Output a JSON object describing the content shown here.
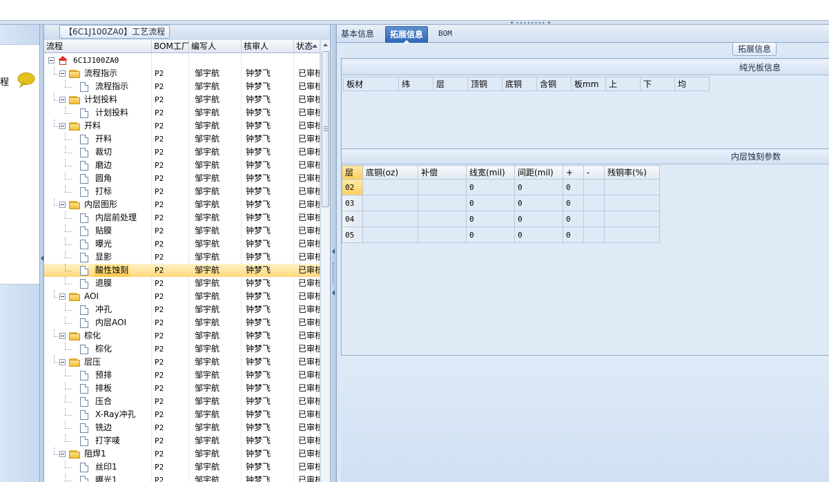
{
  "top": {
    "grip": "▾ ∙∙∙∙∙∙∙∙ ▾"
  },
  "left_panel": {
    "label": "程"
  },
  "tree": {
    "title": "【6C1J100ZA0】工艺流程",
    "columns": [
      "流程",
      "BOM工厂",
      "编写人",
      "核审人",
      "状态"
    ],
    "rows": [
      {
        "level": 0,
        "icon": "home",
        "name": "6C1J100ZA0",
        "bom": "",
        "writer": "",
        "reviewer": "",
        "status": "",
        "expanded": true
      },
      {
        "level": 1,
        "icon": "folder",
        "name": "流程指示",
        "bom": "P2",
        "writer": "邹宇航",
        "reviewer": "钟梦飞",
        "status": "已审核",
        "expanded": true
      },
      {
        "level": 2,
        "icon": "doc",
        "name": "流程指示",
        "bom": "P2",
        "writer": "邹宇航",
        "reviewer": "钟梦飞",
        "status": "已审核"
      },
      {
        "level": 1,
        "icon": "folder",
        "name": "计划投料",
        "bom": "P2",
        "writer": "邹宇航",
        "reviewer": "钟梦飞",
        "status": "已审核",
        "expanded": true
      },
      {
        "level": 2,
        "icon": "doc",
        "name": "计划投料",
        "bom": "P2",
        "writer": "邹宇航",
        "reviewer": "钟梦飞",
        "status": "已审核"
      },
      {
        "level": 1,
        "icon": "folder",
        "name": "开料",
        "bom": "P2",
        "writer": "邹宇航",
        "reviewer": "钟梦飞",
        "status": "已审核",
        "expanded": true
      },
      {
        "level": 2,
        "icon": "doc",
        "name": "开料",
        "bom": "P2",
        "writer": "邹宇航",
        "reviewer": "钟梦飞",
        "status": "已审核"
      },
      {
        "level": 2,
        "icon": "doc",
        "name": "裁切",
        "bom": "P2",
        "writer": "邹宇航",
        "reviewer": "钟梦飞",
        "status": "已审核"
      },
      {
        "level": 2,
        "icon": "doc",
        "name": "磨边",
        "bom": "P2",
        "writer": "邹宇航",
        "reviewer": "钟梦飞",
        "status": "已审核"
      },
      {
        "level": 2,
        "icon": "doc",
        "name": "圆角",
        "bom": "P2",
        "writer": "邹宇航",
        "reviewer": "钟梦飞",
        "status": "已审核"
      },
      {
        "level": 2,
        "icon": "doc",
        "name": "打标",
        "bom": "P2",
        "writer": "邹宇航",
        "reviewer": "钟梦飞",
        "status": "已审核"
      },
      {
        "level": 1,
        "icon": "folder",
        "name": "内层图形",
        "bom": "P2",
        "writer": "邹宇航",
        "reviewer": "钟梦飞",
        "status": "已审核",
        "expanded": true
      },
      {
        "level": 2,
        "icon": "doc",
        "name": "内层前处理",
        "bom": "P2",
        "writer": "邹宇航",
        "reviewer": "钟梦飞",
        "status": "已审核"
      },
      {
        "level": 2,
        "icon": "doc",
        "name": "贴膜",
        "bom": "P2",
        "writer": "邹宇航",
        "reviewer": "钟梦飞",
        "status": "已审核"
      },
      {
        "level": 2,
        "icon": "doc",
        "name": "曝光",
        "bom": "P2",
        "writer": "邹宇航",
        "reviewer": "钟梦飞",
        "status": "已审核"
      },
      {
        "level": 2,
        "icon": "doc",
        "name": "显影",
        "bom": "P2",
        "writer": "邹宇航",
        "reviewer": "钟梦飞",
        "status": "已审核"
      },
      {
        "level": 2,
        "icon": "doc",
        "name": "酸性蚀刻",
        "bom": "P2",
        "writer": "邹宇航",
        "reviewer": "钟梦飞",
        "status": "已审核",
        "selected": true
      },
      {
        "level": 2,
        "icon": "doc",
        "name": "退膜",
        "bom": "P2",
        "writer": "邹宇航",
        "reviewer": "钟梦飞",
        "status": "已审核"
      },
      {
        "level": 1,
        "icon": "folder",
        "name": "AOI",
        "bom": "P2",
        "writer": "邹宇航",
        "reviewer": "钟梦飞",
        "status": "已审核",
        "expanded": true
      },
      {
        "level": 2,
        "icon": "doc",
        "name": "冲孔",
        "bom": "P2",
        "writer": "邹宇航",
        "reviewer": "钟梦飞",
        "status": "已审核"
      },
      {
        "level": 2,
        "icon": "doc",
        "name": "内层AOI",
        "bom": "P2",
        "writer": "邹宇航",
        "reviewer": "钟梦飞",
        "status": "已审核"
      },
      {
        "level": 1,
        "icon": "folder",
        "name": "棕化",
        "bom": "P2",
        "writer": "邹宇航",
        "reviewer": "钟梦飞",
        "status": "已审核",
        "expanded": true
      },
      {
        "level": 2,
        "icon": "doc",
        "name": "棕化",
        "bom": "P2",
        "writer": "邹宇航",
        "reviewer": "钟梦飞",
        "status": "已审核"
      },
      {
        "level": 1,
        "icon": "folder",
        "name": "层压",
        "bom": "P2",
        "writer": "邹宇航",
        "reviewer": "钟梦飞",
        "status": "已审核",
        "expanded": true
      },
      {
        "level": 2,
        "icon": "doc",
        "name": "预排",
        "bom": "P2",
        "writer": "邹宇航",
        "reviewer": "钟梦飞",
        "status": "已审核"
      },
      {
        "level": 2,
        "icon": "doc",
        "name": "排板",
        "bom": "P2",
        "writer": "邹宇航",
        "reviewer": "钟梦飞",
        "status": "已审核"
      },
      {
        "level": 2,
        "icon": "doc",
        "name": "压合",
        "bom": "P2",
        "writer": "邹宇航",
        "reviewer": "钟梦飞",
        "status": "已审核"
      },
      {
        "level": 2,
        "icon": "doc",
        "name": "X-Ray冲孔",
        "bom": "P2",
        "writer": "邹宇航",
        "reviewer": "钟梦飞",
        "status": "已审核"
      },
      {
        "level": 2,
        "icon": "doc",
        "name": "铣边",
        "bom": "P2",
        "writer": "邹宇航",
        "reviewer": "钟梦飞",
        "status": "已审核"
      },
      {
        "level": 2,
        "icon": "doc",
        "name": "打字唛",
        "bom": "P2",
        "writer": "邹宇航",
        "reviewer": "钟梦飞",
        "status": "已审核"
      },
      {
        "level": 1,
        "icon": "folder",
        "name": "阻焊1",
        "bom": "P2",
        "writer": "邹宇航",
        "reviewer": "钟梦飞",
        "status": "已审核",
        "expanded": true
      },
      {
        "level": 2,
        "icon": "doc",
        "name": "丝印1",
        "bom": "P2",
        "writer": "邹宇航",
        "reviewer": "钟梦飞",
        "status": "已审核"
      },
      {
        "level": 2,
        "icon": "doc",
        "name": "曝光1",
        "bom": "P2",
        "writer": "邹宇航",
        "reviewer": "钟梦飞",
        "status": "已审核"
      }
    ]
  },
  "right": {
    "tabs": [
      {
        "label": "基本信息",
        "active": false
      },
      {
        "label": "拓展信息",
        "active": true
      },
      {
        "label": "BOM",
        "active": false
      }
    ],
    "ext_button": "拓展信息",
    "board_section": {
      "title": "纯光板信息",
      "columns": [
        "板材",
        "纬",
        "层",
        "顶铜",
        "底铜",
        "含铜",
        "板mm",
        "上",
        "下",
        "均"
      ]
    },
    "etch_section": {
      "title": "内层蚀刻参数",
      "columns": [
        "层",
        "底铜(oz)",
        "补偿",
        "线宽(mil)",
        "间距(mil)",
        "+",
        "-",
        "残铜率(%)"
      ],
      "rows": [
        {
          "layer": "02",
          "base_copper": "",
          "comp": "",
          "width": "0",
          "spacing": "0",
          "plus": "0",
          "minus": "",
          "residual": ""
        },
        {
          "layer": "03",
          "base_copper": "",
          "comp": "",
          "width": "0",
          "spacing": "0",
          "plus": "0",
          "minus": "",
          "residual": ""
        },
        {
          "layer": "04",
          "base_copper": "",
          "comp": "",
          "width": "0",
          "spacing": "0",
          "plus": "0",
          "minus": "",
          "residual": ""
        },
        {
          "layer": "05",
          "base_copper": "",
          "comp": "",
          "width": "0",
          "spacing": "0",
          "plus": "0",
          "minus": "",
          "residual": ""
        }
      ]
    }
  }
}
